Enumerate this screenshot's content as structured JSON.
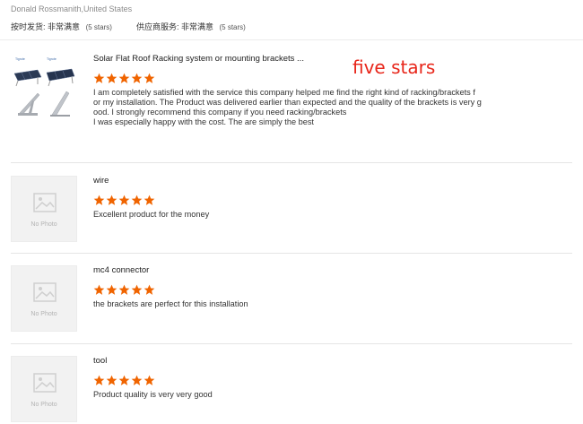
{
  "reviewer": {
    "name": "Donald Rossmanith,United States"
  },
  "ratings": {
    "shipping_label": "按时发货:",
    "shipping_value": "非常满意",
    "shipping_count": "(5 stars)",
    "service_label": "供应商服务:",
    "service_value": "非常满意",
    "service_count": "(5 stars)"
  },
  "annotation": "five stars",
  "colors": {
    "star": "#f06400",
    "annotation": "#e8261a",
    "divider": "#e5e5e5"
  },
  "reviews": [
    {
      "title": "Solar Flat Roof Racking system or mounting brackets ...",
      "stars": 5,
      "thumb": "product-photo",
      "lines": [
        "I am completely satisfied with the service this company helped me find the right kind of racking/brackets f",
        "or my installation. The Product was delivered earlier than expected and the quality of the brackets is very g",
        "ood. I strongly recommend this company if you need racking/brackets",
        "I was especially happy with the cost. The are simply the best"
      ]
    },
    {
      "title": "wire",
      "stars": 5,
      "thumb": "no-photo",
      "no_photo_label": "No Photo",
      "lines": [
        "Excellent product for the money"
      ]
    },
    {
      "title": "mc4 connector",
      "stars": 5,
      "thumb": "no-photo",
      "no_photo_label": "No Photo",
      "lines": [
        "the brackets are perfect for this installation"
      ]
    },
    {
      "title": "tool",
      "stars": 5,
      "thumb": "no-photo",
      "no_photo_label": "No Photo",
      "lines": [
        "Product quality is very very good"
      ]
    }
  ]
}
